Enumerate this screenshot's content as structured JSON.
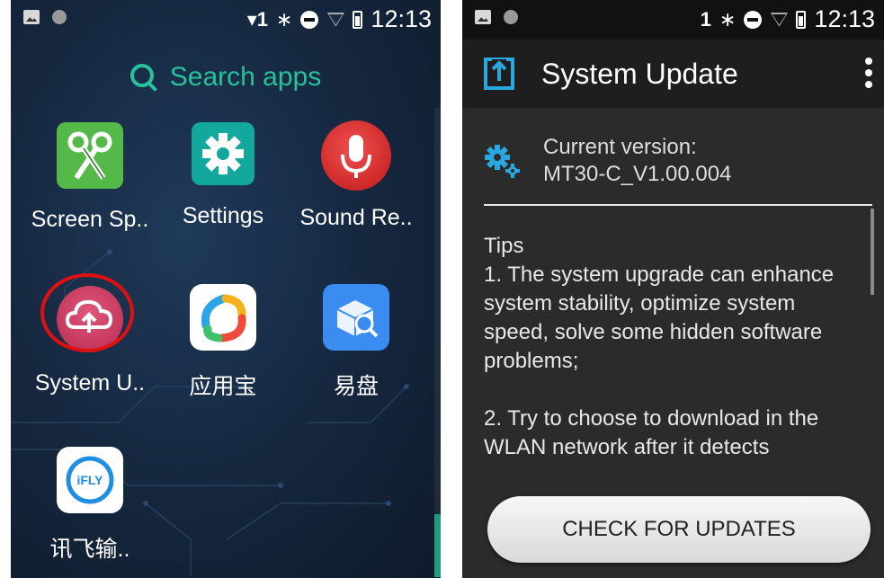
{
  "left": {
    "status": {
      "network": "▾1",
      "time": "12:13"
    },
    "search": {
      "label": "Search apps"
    },
    "apps": [
      {
        "label": "Screen Sp..",
        "icon": "scissors-icon"
      },
      {
        "label": "Settings",
        "icon": "settings-gear-icon"
      },
      {
        "label": "Sound Re..",
        "icon": "microphone-icon"
      },
      {
        "label": "System U..",
        "icon": "cloud-upload-icon"
      },
      {
        "label": "应用宝",
        "icon": "yingyongbao-icon"
      },
      {
        "label": "易盘",
        "icon": "yipan-box-icon"
      },
      {
        "label": "讯飞输..",
        "icon": "ifly-icon"
      }
    ],
    "ifly_logo_text": "iFLY"
  },
  "right": {
    "status": {
      "network": "1",
      "time": "12:13"
    },
    "title": "System Update",
    "version_label": "Current version:",
    "version_value": "MT30-C_V1.00.004",
    "tips_heading": "Tips",
    "tip_1": "1. The system upgrade can enhance system stability, optimize system speed, solve some hidden software problems;",
    "tip_2": " 2. Try to choose to download in the WLAN network after it detects",
    "check_button": "CHECK FOR UPDATES"
  },
  "colors": {
    "accent_teal": "#27c29c",
    "highlight_red": "#e01010",
    "update_blue": "#29a7df"
  }
}
